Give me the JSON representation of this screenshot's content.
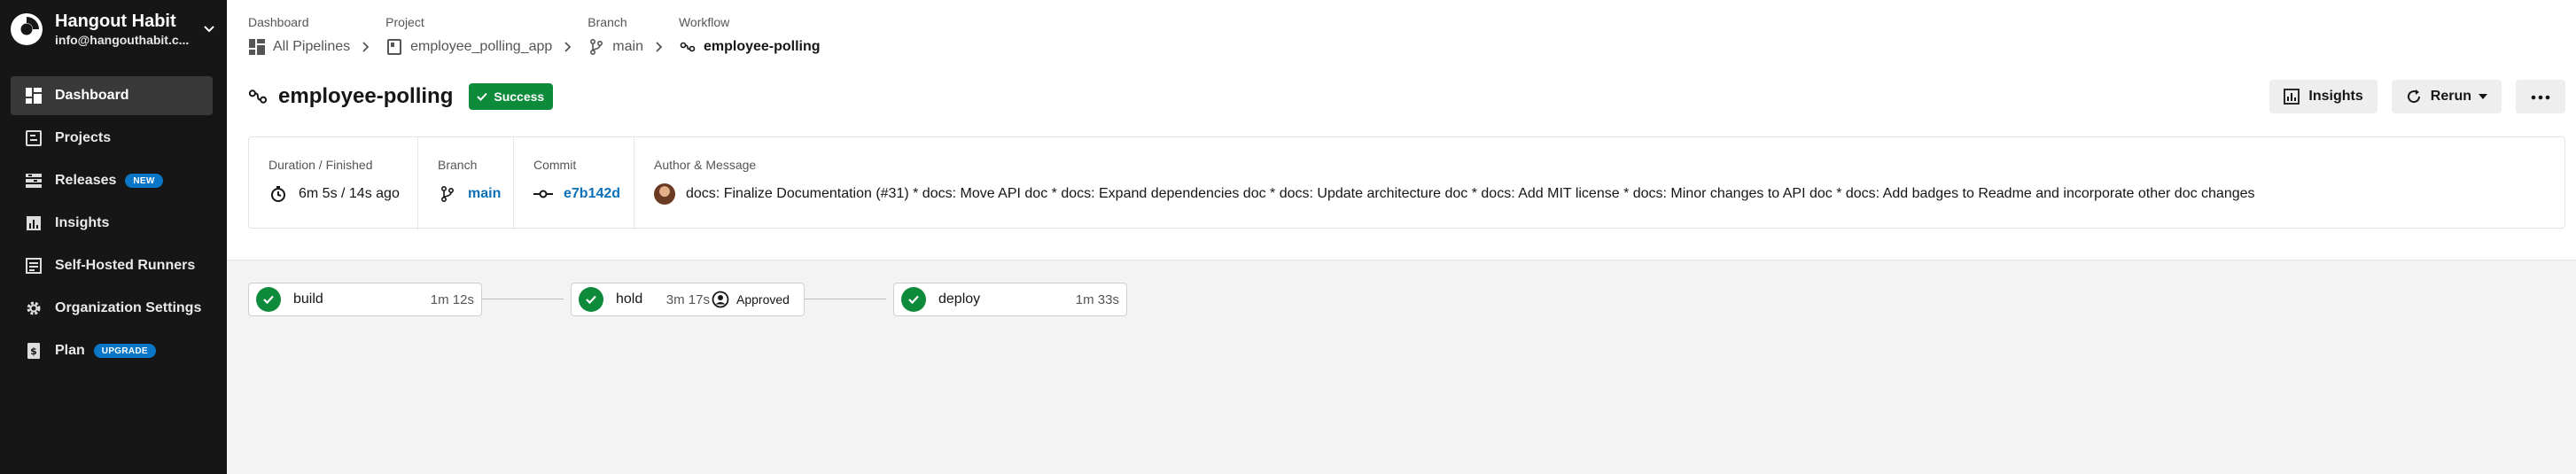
{
  "org": {
    "name": "Hangout Habit",
    "email": "info@hangouthabit.c..."
  },
  "sidebar": {
    "items": [
      {
        "label": "Dashboard",
        "icon": "dashboard-icon",
        "active": true
      },
      {
        "label": "Projects",
        "icon": "projects-icon"
      },
      {
        "label": "Releases",
        "icon": "releases-icon",
        "badge": "NEW"
      },
      {
        "label": "Insights",
        "icon": "insights-icon"
      },
      {
        "label": "Self-Hosted Runners",
        "icon": "runners-icon"
      },
      {
        "label": "Organization Settings",
        "icon": "gear-icon"
      },
      {
        "label": "Plan",
        "icon": "plan-icon",
        "badge": "UPGRADE"
      }
    ]
  },
  "breadcrumb": {
    "items": [
      {
        "label": "Dashboard",
        "value": "All Pipelines",
        "icon": "pipelines-icon"
      },
      {
        "label": "Project",
        "value": "employee_polling_app",
        "icon": "project-icon"
      },
      {
        "label": "Branch",
        "value": "main",
        "icon": "branch-icon"
      },
      {
        "label": "Workflow",
        "value": "employee-polling",
        "icon": "workflow-icon"
      }
    ]
  },
  "workflow": {
    "title": "employee-polling",
    "status": "Success"
  },
  "actions": {
    "insights_label": "Insights",
    "rerun_label": "Rerun"
  },
  "meta": {
    "duration_label": "Duration / Finished",
    "duration_value": "6m 5s / 14s ago",
    "branch_label": "Branch",
    "branch_value": "main",
    "commit_label": "Commit",
    "commit_value": "e7b142d",
    "author_label": "Author & Message",
    "message": "docs: Finalize Documentation (#31) * docs: Move API doc * docs: Expand dependencies doc * docs: Update architecture doc * docs: Add MIT license * docs: Minor changes to API doc * docs: Add badges to Readme and incorporate other doc changes"
  },
  "jobs": [
    {
      "name": "build",
      "duration": "1m 12s"
    },
    {
      "name": "hold",
      "duration": "3m 17s",
      "approval": "Approved"
    },
    {
      "name": "deploy",
      "duration": "1m 33s"
    }
  ],
  "colors": {
    "sidebar_bg": "#161616",
    "sidebar_active": "#393939",
    "success": "#0d8a3a",
    "link": "#0a70b8",
    "badge": "#0a76c8"
  }
}
